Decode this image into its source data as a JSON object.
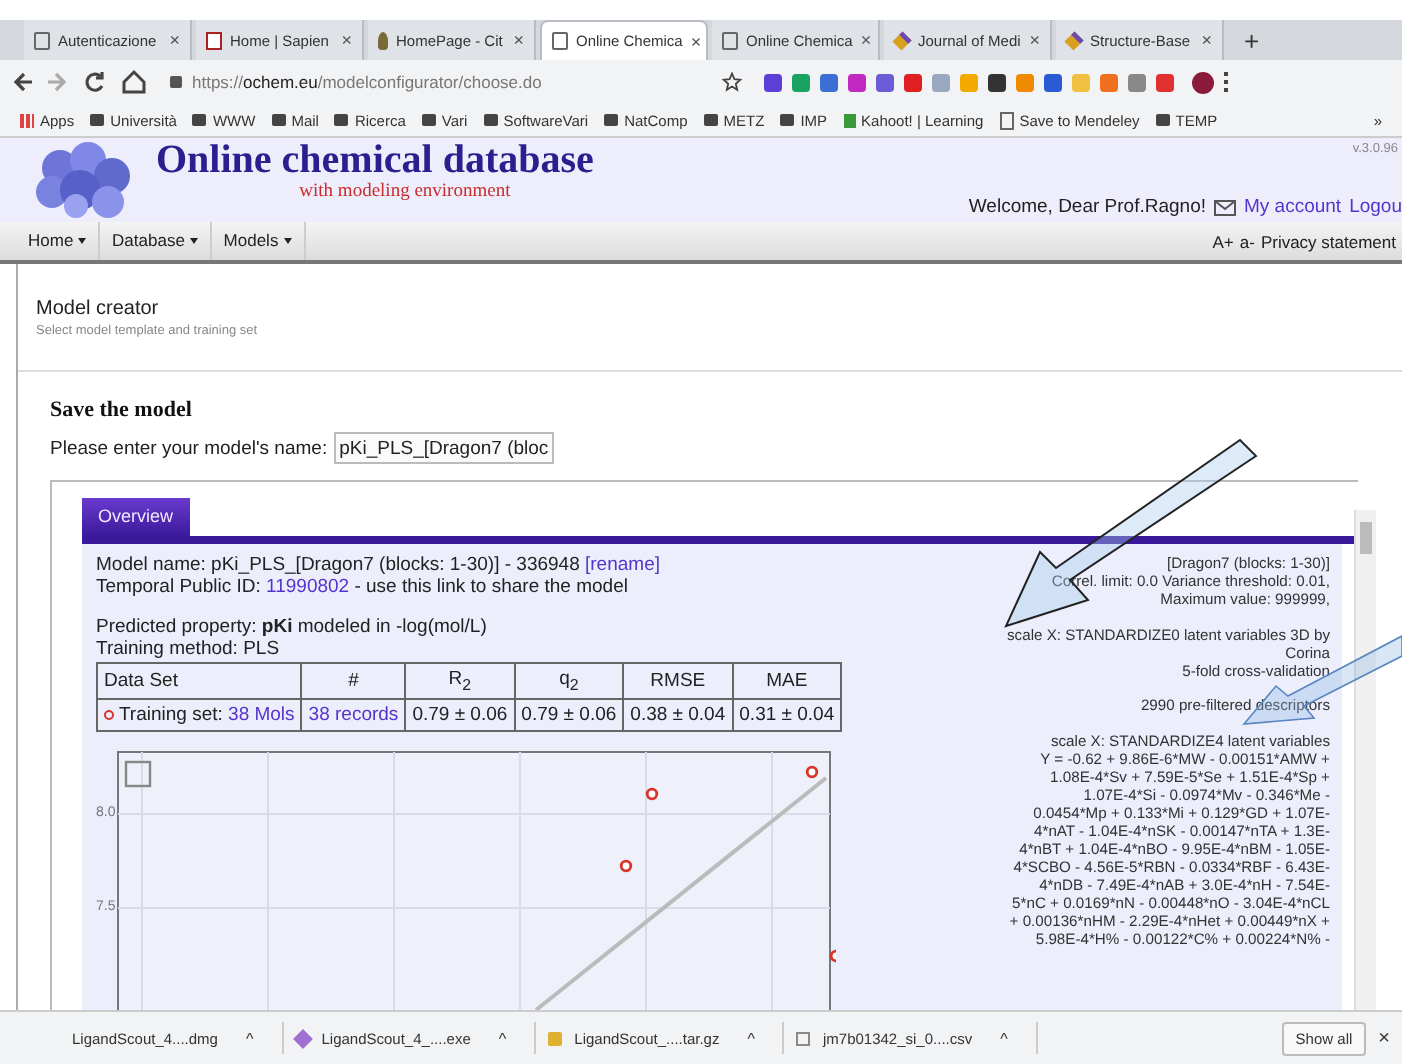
{
  "browser": {
    "tabs": [
      {
        "title": "Autenticazione",
        "kind": "page",
        "selected": false
      },
      {
        "title": "Home | Sapien",
        "kind": "sapienza",
        "selected": false
      },
      {
        "title": "HomePage - Cit",
        "kind": "leaf",
        "selected": false
      },
      {
        "title": "Online Chemica",
        "kind": "page",
        "selected": true
      },
      {
        "title": "Online Chemica",
        "kind": "page",
        "selected": false
      },
      {
        "title": "Journal of Medi",
        "kind": "diamond",
        "selected": false
      },
      {
        "title": "Structure-Base",
        "kind": "diamond",
        "selected": false
      }
    ],
    "tab_close": "×",
    "new_tab": "+",
    "address": {
      "scheme": "https://",
      "domain": "ochem.eu",
      "path": "/modelconfigurator/choose.do"
    },
    "bookmarks": [
      {
        "label": "Apps",
        "kind": "apps"
      },
      {
        "label": "Università",
        "kind": "folder"
      },
      {
        "label": "WWW",
        "kind": "folder"
      },
      {
        "label": "Mail",
        "kind": "folder"
      },
      {
        "label": "Ricerca",
        "kind": "folder"
      },
      {
        "label": "Vari",
        "kind": "folder"
      },
      {
        "label": "SoftwareVari",
        "kind": "folder"
      },
      {
        "label": "NatComp",
        "kind": "folder"
      },
      {
        "label": "METZ",
        "kind": "folder"
      },
      {
        "label": "IMP",
        "kind": "folder"
      },
      {
        "label": "Kahoot! | Learning",
        "kind": "kahoot"
      },
      {
        "label": "Save to Mendeley",
        "kind": "page"
      },
      {
        "label": "TEMP",
        "kind": "folder"
      }
    ],
    "bookmarks_more": "»"
  },
  "site": {
    "title": "Online chemical database",
    "subtitle": "with modeling environment",
    "version": "v.3.0.96",
    "welcome": "Welcome, Dear Prof.Ragno!",
    "account": "My account",
    "logout": "Logou",
    "menu": [
      "Home",
      "Database",
      "Models"
    ],
    "menu_right": [
      "A+",
      "a-",
      "Privacy statement"
    ]
  },
  "page": {
    "heading": "Model creator",
    "subheading": "Select model template and training set",
    "section_title": "Save the model",
    "name_label": "Please enter your model's name:",
    "name_value": "pKi_PLS_[Dragon7 (bloc",
    "overview": {
      "tab": {
        "label": "Overview",
        "selected": true
      },
      "model_name": "Model name: pKi_PLS_[Dragon7 (blocks: 1-30)] - 336948",
      "rename": "[rename]",
      "public_id_label": "Temporal Public ID:",
      "public_id": "11990802",
      "public_id_note": "- use this link to share the model",
      "predicted": "Predicted property: **pKi** modeled in -log(mol/L)",
      "method": "Training method: PLS",
      "table": {
        "columns": [
          "Data Set",
          "#",
          "R$_{2}$",
          "q$_{2}$",
          "RMSE",
          "MAE"
        ],
        "rows": [
          {
            "color": "#d9342b",
            "label": "Training set:",
            "mols": "38 Mols",
            "records": "38 records",
            "r2": "0.79 ± 0.06",
            "q2": "0.79 ± 0.06",
            "rmse": "0.38 ± 0.04",
            "mae": "0.31 ± 0.04"
          }
        ]
      },
      "chart_yticks": [
        "8.0",
        "7.5"
      ],
      "details": [
        {
          "lines": [
            "[Dragon7 (blocks: 1-30)]",
            "Correl. limit: 0.0 Variance threshold: 0.01,",
            "Maximum value: 999999,"
          ]
        },
        {
          "lines": [
            "scale X: STANDARDIZE0 latent variables 3D by",
            "Corina",
            "5-fold cross-validation"
          ]
        },
        {
          "lines": [
            "2990 pre-filtered descriptors"
          ]
        },
        {
          "lines": [
            "scale X: STANDARDIZE4 latent variables",
            "Y = -0.62 + 9.86E-6*MW - 0.00151*AMW +",
            "1.08E-4*Sv + 7.59E-5*Se + 1.51E-4*Sp +",
            "1.07E-4*Si - 0.0974*Mv - 0.346*Me -",
            "0.0454*Mp + 0.133*Mi + 0.129*GD + 1.07E-",
            "4*nAT - 1.04E-4*nSK - 0.00147*nTA + 1.3E-",
            "4*nBT + 1.04E-4*nBO - 9.95E-4*nBM - 1.05E-",
            "4*SCBO - 4.56E-5*RBN - 0.0334*RBF - 6.43E-",
            "4*nDB - 7.49E-4*nAB + 3.0E-4*nH - 7.54E-",
            "5*nC + 0.0169*nN - 0.00448*nO - 3.04E-4*nCL",
            "+ 0.00136*nHM - 2.29E-4*nHet + 0.00449*nX +",
            "5.98E-4*H% - 0.00122*C% + 0.00224*N% -"
          ]
        }
      ]
    }
  },
  "downloads": {
    "items": [
      {
        "name": "LigandScout_4....dmg",
        "kind": "none"
      },
      {
        "name": "LigandScout_4_....exe",
        "kind": "exe"
      },
      {
        "name": "LigandScout_....tar.gz",
        "kind": "archive"
      },
      {
        "name": "jm7b01342_si_0....csv",
        "kind": "page"
      }
    ],
    "caret": "^",
    "show_all": "Show all",
    "close": "×"
  }
}
